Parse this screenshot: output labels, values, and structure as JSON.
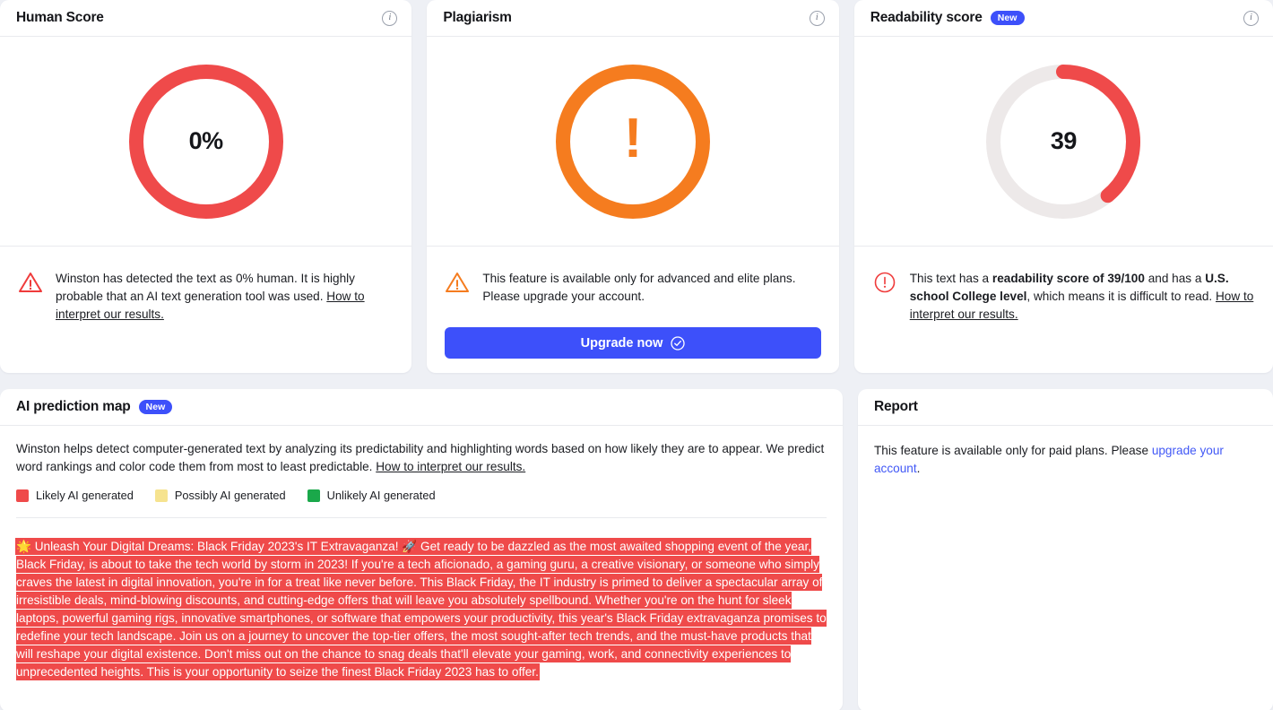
{
  "cards": {
    "human_score": {
      "title": "Human Score",
      "gauge": {
        "value_label": "0%",
        "percent": 0,
        "color": "#ef4a4a",
        "track": "#ede9e9"
      },
      "note_icon": "warning-triangle-red",
      "note_part1": "Winston has detected the text as 0% human. It is highly probable that an AI text generation tool was used. ",
      "note_link": "How to interpret our results."
    },
    "plagiarism": {
      "title": "Plagiarism",
      "gauge": {
        "value_label": "!",
        "color": "#f57c1f"
      },
      "note_icon": "warning-triangle-orange",
      "note_text": "This feature is available only for advanced and elite plans. Please upgrade your account.",
      "button_label": "Upgrade now"
    },
    "readability": {
      "title": "Readability score",
      "badge": "New",
      "gauge": {
        "value_label": "39",
        "percent": 39,
        "color": "#ef4a4a",
        "track": "#ede9e9"
      },
      "note_icon": "alert-circle-red",
      "note_prefix": "This text has a ",
      "note_bold1": "readability score of 39/100",
      "note_mid": " and has a ",
      "note_bold2": "U.S. school College level",
      "note_suffix": ", which means it is difficult to read. ",
      "note_link": "How to interpret our results."
    }
  },
  "prediction_map": {
    "title": "AI prediction map",
    "badge": "New",
    "description_part1": "Winston helps detect computer-generated text by analyzing its predictability and highlighting words based on how likely they are to appear. We predict word rankings and color code them from most to least predictable. ",
    "description_link": "How to interpret our results.",
    "legend": [
      {
        "label": "Likely AI generated",
        "color": "#ef4a4a"
      },
      {
        "label": "Possibly AI generated",
        "color": "#f6e38f"
      },
      {
        "label": "Unlikely AI generated",
        "color": "#1aa84a"
      }
    ],
    "analyzed_text": "🌟 Unleash Your Digital Dreams: Black Friday 2023's IT Extravaganza! 🚀 Get ready to be dazzled as the most awaited shopping event of the year, Black Friday, is about to take the tech world by storm in 2023! If you're a tech aficionado, a gaming guru, a creative visionary, or someone who simply craves the latest in digital innovation, you're in for a treat like never before. This Black Friday, the IT industry is primed to deliver a spectacular array of irresistible deals, mind-blowing discounts, and cutting-edge offers that will leave you absolutely spellbound. Whether you're on the hunt for sleek laptops, powerful gaming rigs, innovative smartphones, or software that empowers your productivity, this year's Black Friday extravaganza promises to redefine your tech landscape. Join us on a journey to uncover the top-tier offers, the most sought-after tech trends, and the must-have products that will reshape your digital existence. Don't miss out on the chance to snag deals that'll elevate your gaming, work, and connectivity experiences to unprecedented heights. This is your opportunity to seize the finest Black Friday 2023 has to offer."
  },
  "report": {
    "title": "Report",
    "text_part1": "This feature is available only for paid plans. Please ",
    "link_text": "upgrade your account",
    "text_part2": "."
  },
  "icons": {
    "info": "i"
  }
}
